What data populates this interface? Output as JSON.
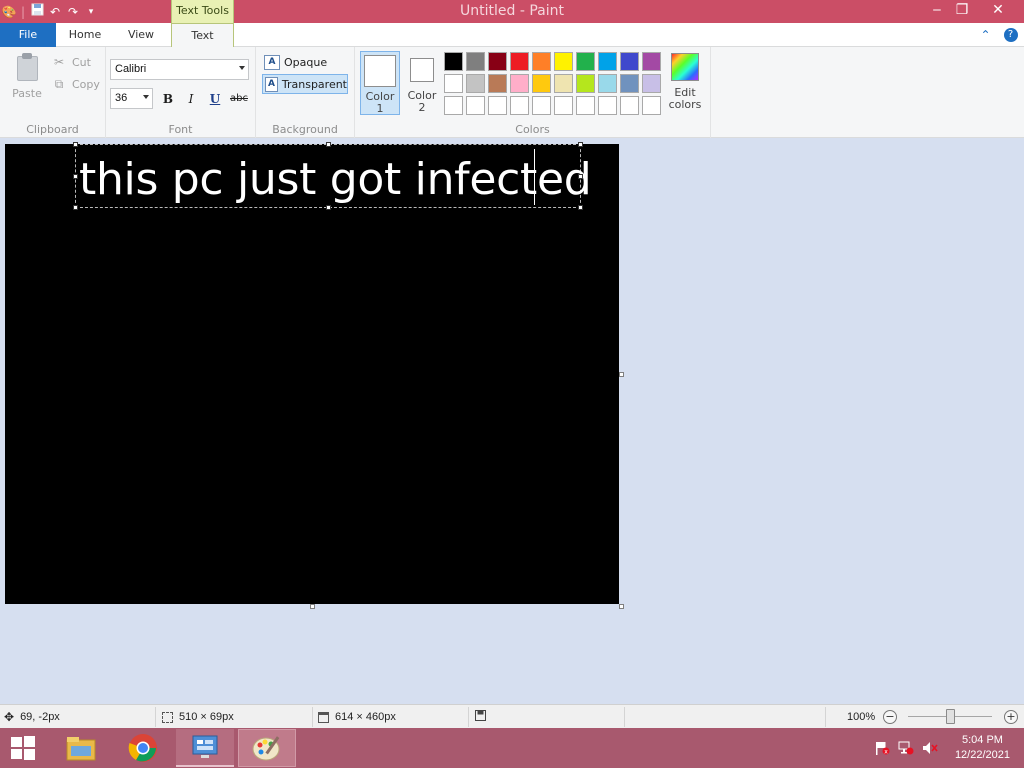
{
  "window": {
    "title": "Untitled - Paint",
    "context_tab": "Text Tools",
    "minimize": "‒",
    "restore": "❐",
    "close": "✕"
  },
  "quick_access": [
    "save-icon",
    "undo-icon",
    "redo-icon",
    "customize-icon"
  ],
  "tabs": [
    {
      "label": "File"
    },
    {
      "label": "Home"
    },
    {
      "label": "View"
    },
    {
      "label": "Text"
    }
  ],
  "help": {
    "collapse": "⌃",
    "help": "?"
  },
  "clipboard": {
    "paste": "Paste",
    "cut": "Cut",
    "copy": "Copy",
    "group": "Clipboard"
  },
  "font": {
    "family": "Calibri",
    "size": "36",
    "bold": "B",
    "italic": "I",
    "underline": "U",
    "strike": "abc",
    "group": "Font"
  },
  "background": {
    "opaque": "Opaque",
    "transparent": "Transparent",
    "selected": "transparent",
    "group": "Background"
  },
  "colors": {
    "color1_label": "Color",
    "color1_num": "1",
    "color1_value": "#ffffff",
    "color2_label": "Color",
    "color2_num": "2",
    "color2_value": "#ffffff",
    "edit_label1": "Edit",
    "edit_label2": "colors",
    "group": "Colors",
    "palette": [
      "#000000",
      "#7f7f7f",
      "#880015",
      "#ed1c24",
      "#ff7f27",
      "#fff200",
      "#22b14c",
      "#00a2e8",
      "#3f48cc",
      "#a349a4",
      "#ffffff",
      "#c3c3c3",
      "#b97a57",
      "#ffaec9",
      "#ffc90e",
      "#efe4b0",
      "#b5e61d",
      "#99d9ea",
      "#7092be",
      "#c8bfe7",
      "#ffffff",
      "#ffffff",
      "#ffffff",
      "#ffffff",
      "#ffffff",
      "#ffffff",
      "#ffffff",
      "#ffffff",
      "#ffffff",
      "#ffffff"
    ]
  },
  "canvas": {
    "background": "#000000",
    "text": "this pc just got infected",
    "text_color": "#ffffff"
  },
  "status": {
    "cursor_pos": "69, -2px",
    "selection_size": "510 × 69px",
    "image_size": "614 × 460px",
    "zoom": "100%"
  },
  "taskbar": {
    "time": "5:04 PM",
    "date": "12/22/2021"
  }
}
